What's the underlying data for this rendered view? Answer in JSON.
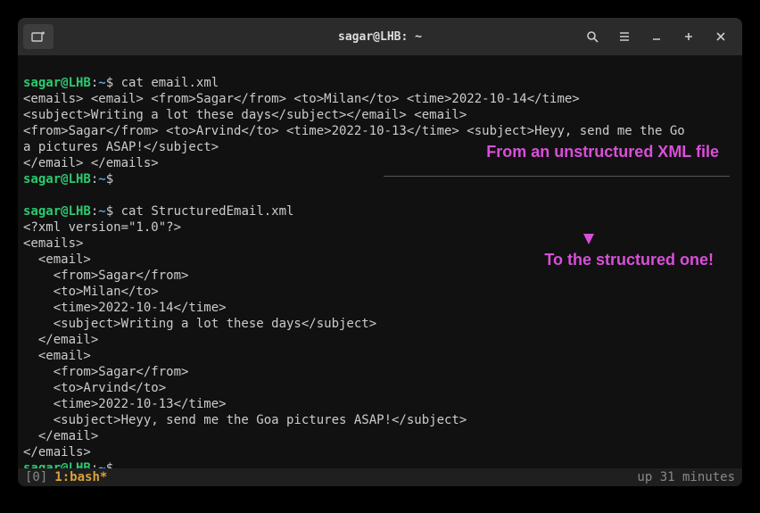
{
  "titlebar": {
    "title": "sagar@LHB: ~"
  },
  "prompt": {
    "user": "sagar@LHB",
    "colon": ":",
    "tilde": "~",
    "dollar": "$"
  },
  "block1": {
    "cmd": " cat email.xml",
    "out": "<emails> <email> <from>Sagar</from> <to>Milan</to> <time>2022-10-14</time>\n<subject>Writing a lot these days</subject></email> <email>\n<from>Sagar</from> <to>Arvind</to> <time>2022-10-13</time> <subject>Heyy, send me the Go\na pictures ASAP!</subject>\n</email> </emails>"
  },
  "block2": {
    "cmd": " cat StructuredEmail.xml",
    "out": "<?xml version=\"1.0\"?>\n<emails>\n  <email>\n    <from>Sagar</from>\n    <to>Milan</to>\n    <time>2022-10-14</time>\n    <subject>Writing a lot these days</subject>\n  </email>\n  <email>\n    <from>Sagar</from>\n    <to>Arvind</to>\n    <time>2022-10-13</time>\n    <subject>Heyy, send me the Goa pictures ASAP!</subject>\n  </email>\n</emails>"
  },
  "annotations": {
    "top": "From an unstructured XML file",
    "bottom": "To the structured one!"
  },
  "statusbar": {
    "index": "[0]",
    "process": "1:bash*",
    "uptime": "up 31 minutes"
  }
}
